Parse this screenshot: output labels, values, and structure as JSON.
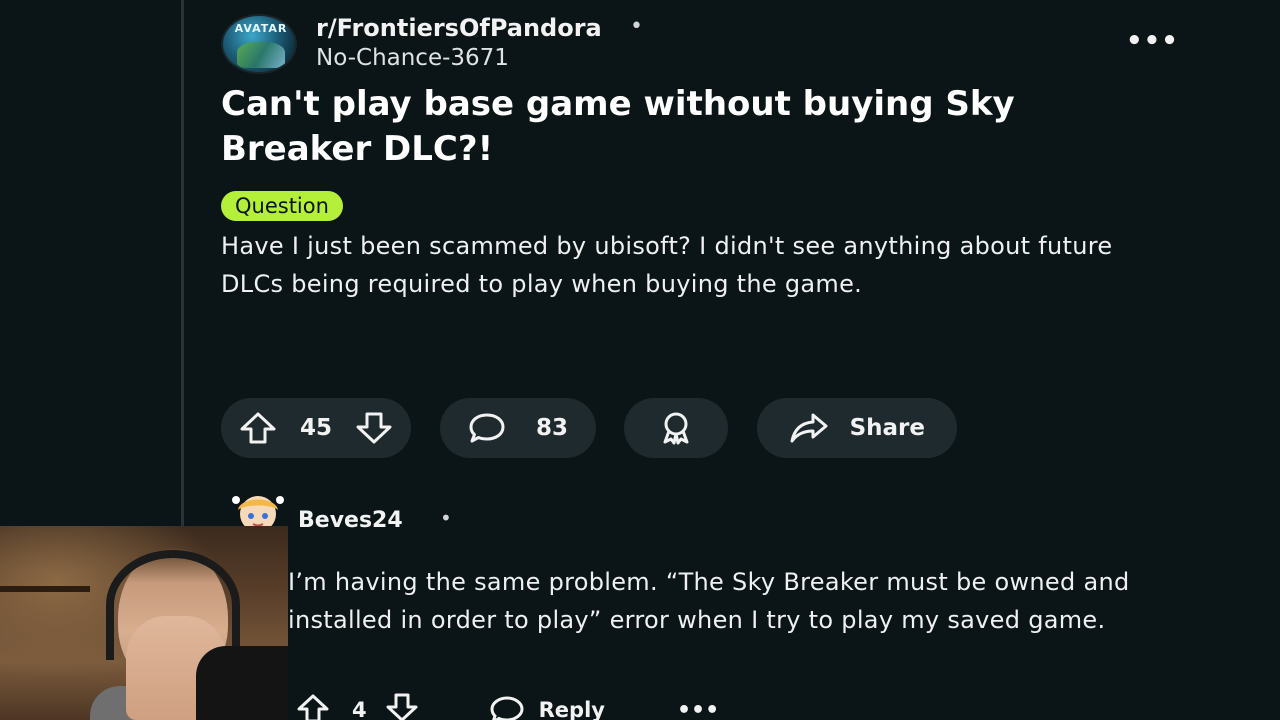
{
  "post": {
    "subreddit": "r/FrontiersOfPandora",
    "separator": "•",
    "author": "No-Chance-3671",
    "title": "Can't play base game without buying Sky Breaker DLC?!",
    "flair": "Question",
    "body": "Have I just been scammed by ubisoft? I didn't see anything about future DLCs being required to play when buying the game.",
    "more_icon": "•••",
    "subreddit_icon_text": "AVATAR",
    "actions": {
      "upvotes": "45",
      "comments": "83",
      "share_label": "Share"
    },
    "colors": {
      "flair_bg": "#b4ef3a",
      "pill_bg": "#1f2a2e",
      "background": "#0b1416"
    }
  },
  "comment": {
    "author": "Beves24",
    "separator": "•",
    "body": "I’m having the same problem. “The Sky Breaker must be owned and installed in order to play” error when I try to play my saved game.",
    "upvotes": "4",
    "reply_label": "Reply",
    "more_icon": "•••"
  }
}
